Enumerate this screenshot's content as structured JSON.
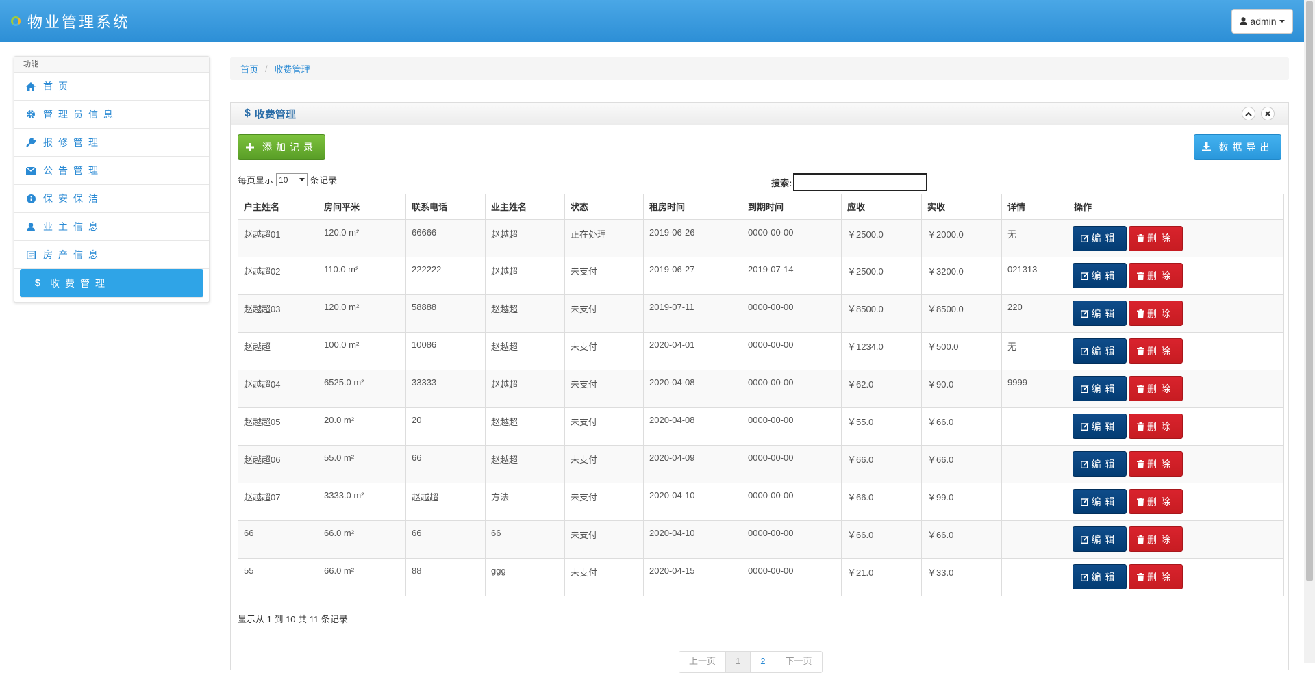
{
  "app": {
    "title": "物业管理系统"
  },
  "user_menu": {
    "label": "admin"
  },
  "sidebar": {
    "header": "功能",
    "items": [
      {
        "label": "首页",
        "icon": "home-icon",
        "active": false
      },
      {
        "label": "管理员信息",
        "icon": "gear-icon",
        "active": false
      },
      {
        "label": "报修管理",
        "icon": "wrench-icon",
        "active": false
      },
      {
        "label": "公告管理",
        "icon": "envelope-icon",
        "active": false
      },
      {
        "label": "保安保洁",
        "icon": "info-icon",
        "active": false
      },
      {
        "label": "业主信息",
        "icon": "user-icon",
        "active": false
      },
      {
        "label": "房产信息",
        "icon": "document-icon",
        "active": false
      },
      {
        "label": "收费管理",
        "icon": "dollar-icon",
        "active": true
      }
    ]
  },
  "breadcrumb": {
    "home": "首页",
    "current": "收费管理"
  },
  "panel": {
    "title": "收费管理",
    "add_label": "添加记录",
    "export_label": "数据导出"
  },
  "table_controls": {
    "length_prefix": "每页显示",
    "length_value": "10",
    "length_suffix": "条记录",
    "search_label": "搜索:"
  },
  "table": {
    "columns": [
      "户主姓名",
      "房间平米",
      "联系电话",
      "业主姓名",
      "状态",
      "租房时间",
      "到期时间",
      "应收",
      "实收",
      "详情",
      "操作"
    ],
    "rows": [
      [
        "赵越超01",
        "120.0 m²",
        "66666",
        "赵越超",
        "正在处理",
        "2019-06-26",
        "0000-00-00",
        "￥2500.0",
        "￥2000.0",
        "无"
      ],
      [
        "赵越超02",
        "110.0 m²",
        "222222",
        "赵越超",
        "未支付",
        "2019-06-27",
        "2019-07-14",
        "￥2500.0",
        "￥3200.0",
        "021313"
      ],
      [
        "赵越超03",
        "120.0 m²",
        "58888",
        "赵越超",
        "未支付",
        "2019-07-11",
        "0000-00-00",
        "￥8500.0",
        "￥8500.0",
        "220"
      ],
      [
        "赵越超",
        "100.0 m²",
        "10086",
        "赵越超",
        "未支付",
        "2020-04-01",
        "0000-00-00",
        "￥1234.0",
        "￥500.0",
        "无"
      ],
      [
        "赵越超04",
        "6525.0 m²",
        "33333",
        "赵越超",
        "未支付",
        "2020-04-08",
        "0000-00-00",
        "￥62.0",
        "￥90.0",
        "9999"
      ],
      [
        "赵越超05",
        "20.0 m²",
        "20",
        "赵越超",
        "未支付",
        "2020-04-08",
        "0000-00-00",
        "￥55.0",
        "￥66.0",
        ""
      ],
      [
        "赵越超06",
        "55.0 m²",
        "66",
        "赵越超",
        "未支付",
        "2020-04-09",
        "0000-00-00",
        "￥66.0",
        "￥66.0",
        ""
      ],
      [
        "赵越超07",
        "3333.0 m²",
        "赵越超",
        "方法",
        "未支付",
        "2020-04-10",
        "0000-00-00",
        "￥66.0",
        "￥99.0",
        ""
      ],
      [
        "66",
        "66.0 m²",
        "66",
        "66",
        "未支付",
        "2020-04-10",
        "0000-00-00",
        "￥66.0",
        "￥66.0",
        ""
      ],
      [
        "55",
        "66.0 m²",
        "88",
        "ggg",
        "未支付",
        "2020-04-15",
        "0000-00-00",
        "￥21.0",
        "￥33.0",
        ""
      ]
    ],
    "edit_label": "编辑",
    "delete_label": "删除"
  },
  "info": "显示从 1 到 10 共 11 条记录",
  "pagination": {
    "first": "上一页",
    "page1": "1",
    "page2": "2",
    "next": "下一页"
  },
  "colors": {
    "navbar": "#2fa4e7",
    "active_menu": "#2fa4e7",
    "edit_button": "#033c73",
    "delete_button": "#c71c22",
    "add_button": "#73a839"
  }
}
